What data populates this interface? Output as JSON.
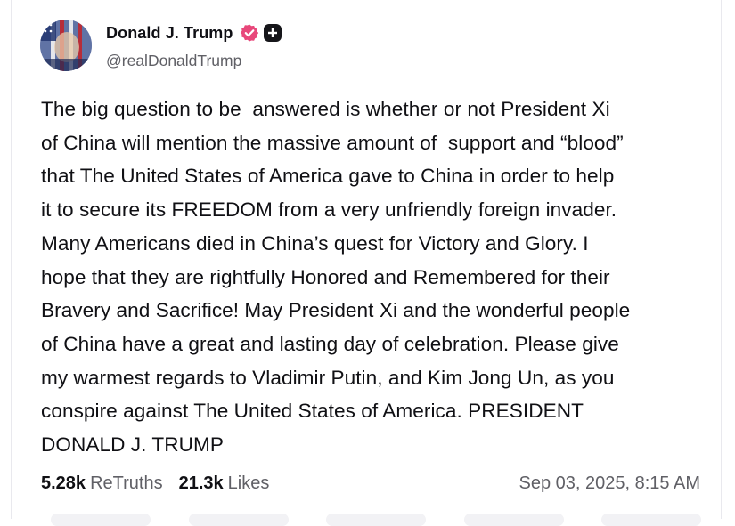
{
  "post": {
    "author": {
      "display_name": "Donald J. Trump",
      "handle": "@realDonaldTrump",
      "verified_icon": "verified-badge-icon",
      "plus_icon": "plus-badge-icon",
      "verified_color": "#e8477a"
    },
    "text": "The big question to be  answered is whether or not President Xi\nof China will mention the massive amount of  support and “blood”\nthat The United States of America gave to China in order to help\nit to secure its FREEDOM from a very unfriendly foreign invader.\nMany Americans died in China’s quest for Victory and Glory. I\nhope that they are rightfully Honored and Remembered for their\nBravery and Sacrifice! May President Xi and the wonderful people\nof China have a great and lasting day of celebration. Please give\nmy warmest regards to Vladimir Putin, and Kim Jong Un, as you\nconspire against The United States of America. PRESIDENT\nDONALD J. TRUMP",
    "retruths_count": "5.28k",
    "retruths_label": "ReTruths",
    "likes_count": "21.3k",
    "likes_label": "Likes",
    "timestamp": "Sep 03, 2025, 8:15 AM"
  }
}
